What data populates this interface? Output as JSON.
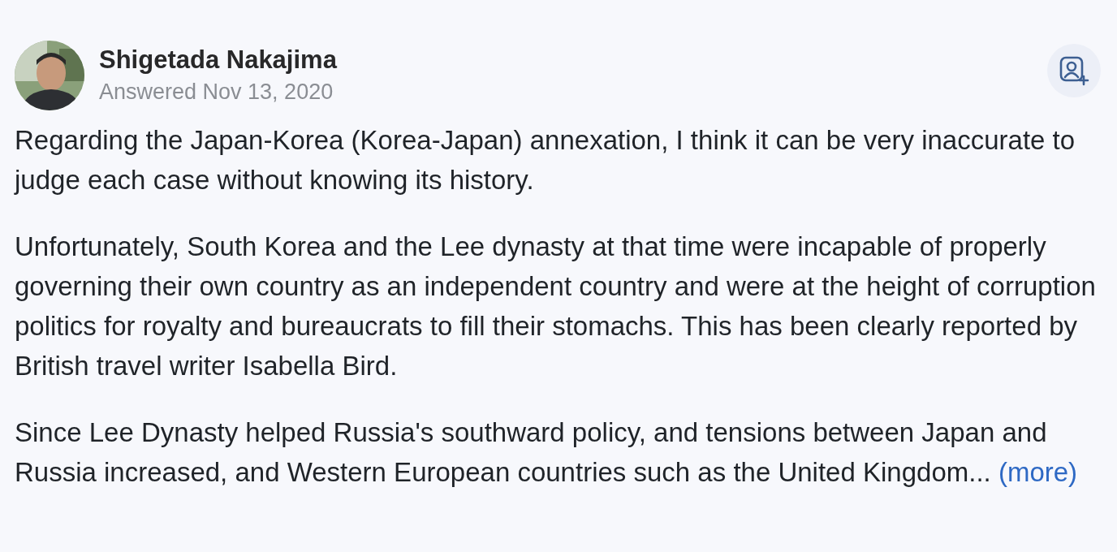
{
  "author": {
    "name": "Shigetada Nakajima",
    "meta": "Answered Nov 13, 2020"
  },
  "answer": {
    "paragraphs": [
      {
        "text": "Regarding the Japan-Korea (Korea-Japan) annexation, I think it can be very inaccurate to judge each case without knowing its history."
      },
      {
        "text": "Unfortunately, South Korea and the Lee dynasty at that time were incapable of properly governing their own country as an independent country and were at the height of corruption politics for royalty and bureaucrats to fill their stomachs. This has been clearly reported by British travel writer Isabella Bird."
      },
      {
        "text": "Since Lee Dynasty helped Russia's southward policy, and tensions between Japan and Russia increased, and Western European countries such as the United Kingdom...",
        "more_link": "(more)"
      }
    ]
  }
}
